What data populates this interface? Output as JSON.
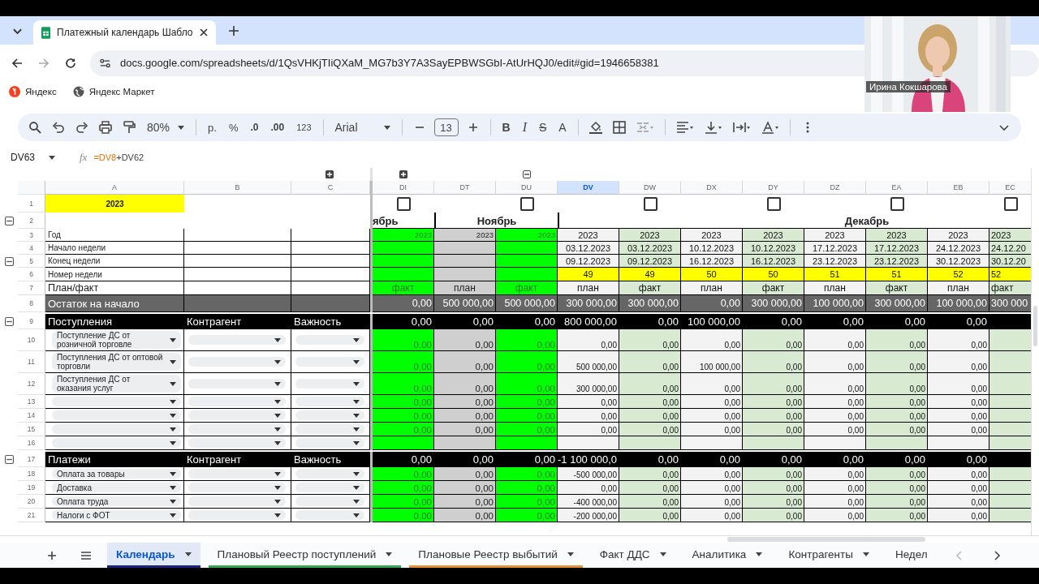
{
  "browser": {
    "tab_title": "Платежный календарь Шабло",
    "url": "docs.google.com/spreadsheets/d/1QsVHKjTIiQXaM_MG7b3Y7A3SayEPBWSGbI-AtUrHQJ0/edit#gid=1946658381",
    "bookmarks": [
      "Яндекс",
      "Яндекс Маркет"
    ]
  },
  "webcam": {
    "kind": "picture",
    "name": "Ирина Кокшарова"
  },
  "toolbar": {
    "zoom": "80%",
    "currency": "р.",
    "percent": "%",
    "decrease_decimals": ".0",
    "increase_decimals": ".00",
    "format": "123",
    "font": "Arial",
    "font_size": "13",
    "bold": "B",
    "italic": "I",
    "strikethrough": "S",
    "text_color": "A"
  },
  "formula_bar": {
    "cell": "DV63",
    "fx": "fx",
    "parts": [
      {
        "text": "=DV8",
        "color": "#e8710a"
      },
      {
        "text": "+DV62",
        "color": "#3c4043"
      }
    ]
  },
  "grid": {
    "left_columns": [
      "A",
      "B",
      "C"
    ],
    "past_columns": [
      {
        "header": "DI",
        "selected": false,
        "kind": "fact",
        "checkbox": {
          "checked": false
        }
      },
      {
        "header": "DT",
        "selected": false,
        "kind": "plan"
      },
      {
        "header": "DU",
        "selected": false,
        "kind": "fact",
        "checkbox": {
          "checked": false
        }
      }
    ],
    "columns": [
      {
        "header": "DV",
        "selected": true,
        "kind": "plan"
      },
      {
        "header": "DW",
        "selected": false,
        "kind": "fact",
        "checkbox": {
          "checked": false
        }
      },
      {
        "header": "DX",
        "selected": false,
        "kind": "plan"
      },
      {
        "header": "DY",
        "selected": false,
        "kind": "fact",
        "checkbox": {
          "checked": false
        }
      },
      {
        "header": "DZ",
        "selected": false,
        "kind": "plan"
      },
      {
        "header": "EA",
        "selected": false,
        "kind": "fact",
        "checkbox": {
          "checked": false
        }
      },
      {
        "header": "EB",
        "selected": false,
        "kind": "plan"
      },
      {
        "header": "EC",
        "selected": false,
        "kind": "fact",
        "checkbox": {
          "checked": false
        }
      }
    ],
    "year_row": {
      "number": "1",
      "label": "2023",
      "toggle": false
    },
    "month_row": {
      "number": "2",
      "toggle": true,
      "months": [
        "ябрь",
        "Ноябрь",
        "Декабрь"
      ]
    },
    "rows": [
      {
        "number": "3",
        "kind": "info",
        "toggle": false,
        "label": "Год",
        "past_values": [
          "2023",
          "2023",
          "2023"
        ],
        "values": [
          "2023",
          "2023",
          "2023",
          "2023",
          "2023",
          "2023",
          "2023",
          "2023"
        ]
      },
      {
        "number": "4",
        "kind": "info",
        "toggle": false,
        "label": "Начало недели",
        "values": [
          "03.12.2023",
          "03.12.2023",
          "10.12.2023",
          "10.12.2023",
          "17.12.2023",
          "17.12.2023",
          "24.12.2023",
          "24.12.20"
        ]
      },
      {
        "number": "5",
        "kind": "info",
        "toggle": true,
        "label": "Конец недели",
        "values": [
          "09.12.2023",
          "09.12.2023",
          "16.12.2023",
          "16.12.2023",
          "23.12.2023",
          "23.12.2023",
          "30.12.2023",
          "30.12.20"
        ]
      },
      {
        "number": "6",
        "kind": "week",
        "toggle": false,
        "label": "Номер недели",
        "values": [
          "49",
          "49",
          "50",
          "50",
          "51",
          "51",
          "52",
          "52"
        ]
      },
      {
        "number": "7",
        "kind": "planfact",
        "toggle": false,
        "label": "План/факт",
        "past_values": [
          "факт",
          "план",
          "факт"
        ],
        "values": [
          "план",
          "факт",
          "план",
          "факт",
          "план",
          "факт",
          "план",
          "факт"
        ]
      },
      {
        "number": "8",
        "kind": "balance",
        "toggle": false,
        "label": "Остаток на начало",
        "past_values": [
          "0,00",
          "500 000,00",
          "500 000,00"
        ],
        "values": [
          "300 000,00",
          "300 000,00",
          "0,00",
          "300 000,00",
          "100 000,00",
          "300 000,00",
          "100 000,00",
          "300 000"
        ]
      },
      {
        "number": "9",
        "kind": "section",
        "toggle": true,
        "label": "Поступления",
        "col_b": "Контрагент",
        "col_c": "Важность",
        "past_values": [
          "0,00",
          "0,00",
          "0,00"
        ],
        "values": [
          "800 000,00",
          "0,00",
          "100 000,00",
          "0,00",
          "0,00",
          "0,00",
          "0,00"
        ]
      },
      {
        "number": "10",
        "kind": "item",
        "toggle": false,
        "label": "Поступление ДС от розничной торговле",
        "past_values": [
          "0,00",
          "0,00",
          "0,00"
        ],
        "values": [
          "0,00",
          "0,00",
          "0,00",
          "0,00",
          "0,00",
          "0,00",
          "0,00"
        ]
      },
      {
        "number": "11",
        "kind": "item",
        "toggle": false,
        "label": "Поступления ДС от оптовой торговли",
        "past_values": [
          "0,00",
          "0,00",
          "0,00"
        ],
        "values": [
          "500 000,00",
          "0,00",
          "100 000,00",
          "0,00",
          "0,00",
          "0,00",
          "0,00"
        ]
      },
      {
        "number": "12",
        "kind": "item",
        "toggle": false,
        "label": "Поступления ДС от оказания услуг",
        "past_values": [
          "0,00",
          "0,00",
          "0,00"
        ],
        "values": [
          "300 000,00",
          "0,00",
          "0,00",
          "0,00",
          "0,00",
          "0,00",
          "0,00"
        ]
      },
      {
        "number": "13",
        "kind": "item",
        "toggle": false,
        "past_values": [
          "0,00",
          "0,00",
          "0,00"
        ],
        "values": [
          "0,00",
          "0,00",
          "0,00",
          "0,00",
          "0,00",
          "0,00",
          "0,00"
        ]
      },
      {
        "number": "14",
        "kind": "item",
        "toggle": false,
        "past_values": [
          "0,00",
          "0,00",
          "0,00"
        ],
        "values": [
          "0,00",
          "0,00",
          "0,00",
          "0,00",
          "0,00",
          "0,00",
          "0,00"
        ]
      },
      {
        "number": "15",
        "kind": "item",
        "toggle": false,
        "past_values": [
          "0,00",
          "0,00",
          "0,00"
        ],
        "values": [
          "0,00",
          "0,00",
          "0,00",
          "0,00",
          "0,00",
          "0,00",
          "0,00"
        ]
      },
      {
        "number": "16",
        "kind": "item",
        "toggle": false
      },
      {
        "number": "17",
        "kind": "section",
        "toggle": true,
        "label": "Платежи",
        "col_b": "Контрагент",
        "col_c": "Важность",
        "past_values": [
          "0,00",
          "0,00",
          "0,00"
        ],
        "values": [
          "-1 100 000,0",
          "0,00",
          "0,00",
          "0,00",
          "0,00",
          "0,00",
          "0,00"
        ]
      },
      {
        "number": "18",
        "kind": "item",
        "toggle": false,
        "label": "Оплата за товары",
        "past_values": [
          "0,00",
          "0,00",
          "0,00"
        ],
        "values": [
          "-500 000,00",
          "0,00",
          "0,00",
          "0,00",
          "0,00",
          "0,00",
          "0,00"
        ]
      },
      {
        "number": "19",
        "kind": "item",
        "toggle": false,
        "label": "Доставка",
        "past_values": [
          "0,00",
          "0,00",
          "0,00"
        ],
        "values": [
          "0,00",
          "0,00",
          "0,00",
          "0,00",
          "0,00",
          "0,00",
          "0,00"
        ]
      },
      {
        "number": "20",
        "kind": "item",
        "toggle": false,
        "label": "Оплата труда",
        "past_values": [
          "0,00",
          "0,00",
          "0,00"
        ],
        "values": [
          "-400 000,00",
          "0,00",
          "0,00",
          "0,00",
          "0,00",
          "0,00",
          "0,00"
        ]
      },
      {
        "number": "21",
        "kind": "item",
        "toggle": false,
        "label": "Налоги с ФОТ",
        "past_values": [
          "0,00",
          "0,00",
          "0,00"
        ],
        "values": [
          "-200 000,00",
          "0,00",
          "0,00",
          "0,00",
          "0,00",
          "0,00",
          "0,00"
        ]
      }
    ]
  },
  "sheet_tabs": [
    {
      "label": "Календарь",
      "selected": true,
      "dropdown": true,
      "color": "#1a237e"
    },
    {
      "label": "Плановый Реестр поступлений",
      "selected": false,
      "dropdown": true,
      "color": "#34a853"
    },
    {
      "label": "Плановые Реестр выбытий",
      "selected": false,
      "dropdown": true,
      "color": "#e69138"
    },
    {
      "label": "Факт ДДС",
      "selected": false,
      "dropdown": true
    },
    {
      "label": "Аналитика",
      "selected": false,
      "dropdown": true
    },
    {
      "label": "Контрагенты",
      "selected": false,
      "dropdown": true
    },
    {
      "label": "Недел",
      "selected": false,
      "dropdown": false
    }
  ]
}
